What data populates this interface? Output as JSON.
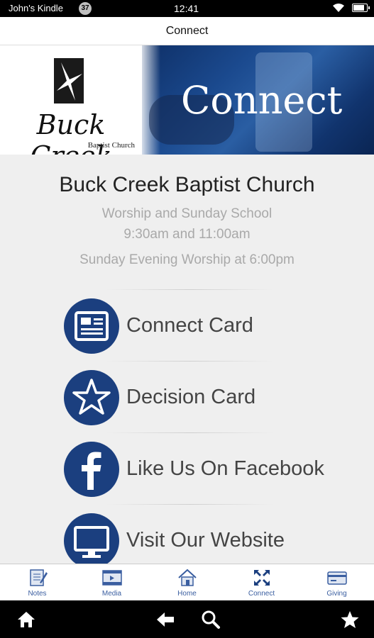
{
  "status_bar": {
    "owner": "John's Kindle",
    "notification_count": "37",
    "time": "12:41",
    "wifi_icon": "wifi-icon",
    "battery_icon": "battery-icon"
  },
  "title_bar": {
    "title": "Connect"
  },
  "banner": {
    "logo_name": "Buck Creek",
    "logo_sub": "Baptist Church",
    "heading": "Connect"
  },
  "church": {
    "name": "Buck Creek Baptist Church",
    "line1": "Worship and Sunday School",
    "line2": "9:30am and 11:00am",
    "line3": "Sunday Evening Worship at 6:00pm"
  },
  "actions": [
    {
      "label": "Connect Card",
      "icon": "card-icon"
    },
    {
      "label": "Decision Card",
      "icon": "star-icon"
    },
    {
      "label": "Like Us On Facebook",
      "icon": "facebook-icon"
    },
    {
      "label": "Visit Our Website",
      "icon": "monitor-icon"
    }
  ],
  "tabs": [
    {
      "label": "Notes",
      "icon": "notes-icon"
    },
    {
      "label": "Media",
      "icon": "film-icon"
    },
    {
      "label": "Home",
      "icon": "house-icon"
    },
    {
      "label": "Connect",
      "icon": "connect-icon",
      "active": true
    },
    {
      "label": "Giving",
      "icon": "credit-card-icon"
    }
  ],
  "system_nav": [
    "home-icon",
    "back-icon",
    "search-icon",
    "favorites-icon"
  ],
  "colors": {
    "brand_blue": "#1b3f7f",
    "tab_blue": "#3a5ea0",
    "background": "#efefef"
  }
}
